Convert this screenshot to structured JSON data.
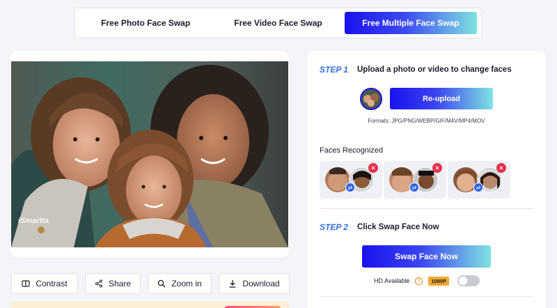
{
  "tabs": [
    {
      "label": "Free Photo Face Swap",
      "active": false
    },
    {
      "label": "Free Video Face Swap",
      "active": false
    },
    {
      "label": "Free Multiple Face Swap",
      "active": true
    }
  ],
  "photo": {
    "watermark": "iSmartta"
  },
  "actions": {
    "contrast": "Contrast",
    "share": "Share",
    "zoom": "Zoom in",
    "download": "Download"
  },
  "step1": {
    "label": "STEP 1",
    "text": "Upload a photo or video to change faces",
    "reupload": "Re-upload",
    "formats": "Formats: JPG/PNG/WEBP/GIF/M4V/MP4/MOV"
  },
  "faces": {
    "title": "Faces Recognized",
    "delete_glyph": "×",
    "swap_glyph": "⇄"
  },
  "step2": {
    "label": "STEP 2",
    "text": "Click Swap Face Now",
    "button": "Swap Face Now",
    "hd_label": "HD Available",
    "info_glyph": "!",
    "badge": "1080P",
    "hd_enabled": false
  },
  "colors": {
    "accent": "#1a12ee",
    "gradient_end": "#7fe3e0",
    "step_label": "#2f6fe8",
    "delete": "#e6334f",
    "badge": "#f2a82c"
  },
  "icons": {
    "contrast": "contrast-icon",
    "share": "share-icon",
    "zoom": "zoom-in-icon",
    "download": "download-icon"
  }
}
